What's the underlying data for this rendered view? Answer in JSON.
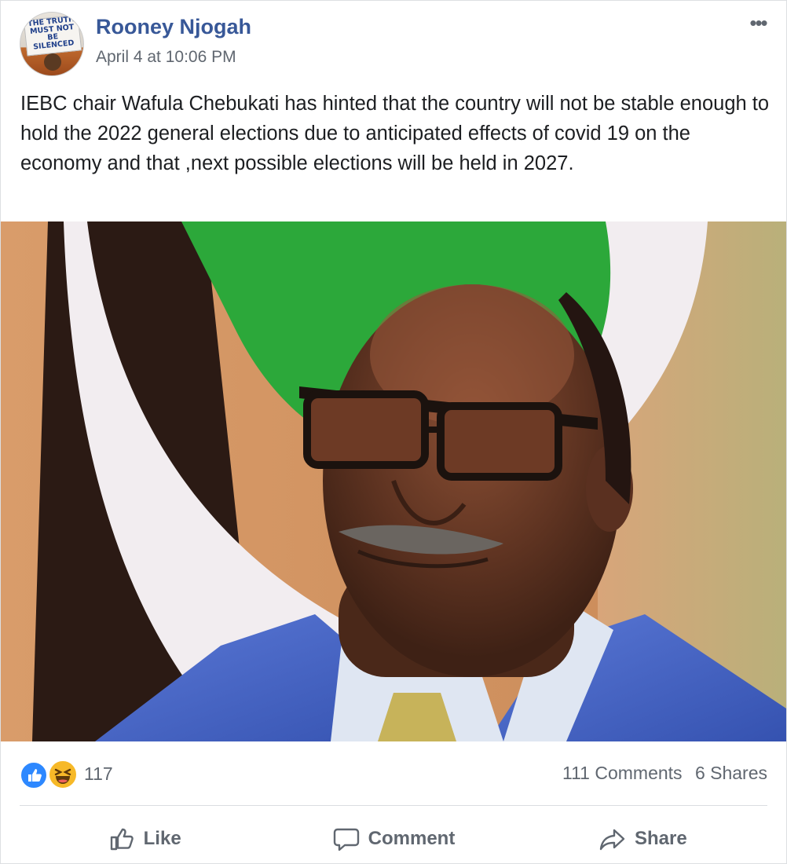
{
  "post": {
    "author": "Rooney Njogah",
    "timestamp": "April 4 at 10:06 PM",
    "text": "IEBC chair Wafula Chebukati has hinted that the country will not be stable enough to hold the 2022 general elections due to anticipated effects of covid 19 on the economy and that ,next possible elections will be held in 2027.",
    "avatar_sign": [
      "THE TRUTH",
      "MUST NOT BE",
      "SILENCED"
    ]
  },
  "reactions": {
    "icons": [
      "like-reaction-icon",
      "haha-reaction-icon"
    ],
    "count": "117"
  },
  "engagement": {
    "comments": "111 Comments",
    "shares": "6 Shares"
  },
  "actions": {
    "like": "Like",
    "comment": "Comment",
    "share": "Share"
  },
  "colors": {
    "author_link": "#385898",
    "secondary_text": "#606770",
    "like_blue": "#2d88ff",
    "haha_yellow": "#f7b928"
  }
}
